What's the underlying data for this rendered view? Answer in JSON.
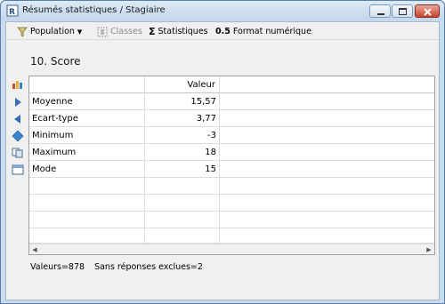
{
  "window": {
    "title": "Résumés statistiques / Stagiaire"
  },
  "toolbar": {
    "population": "Population",
    "classes": "Classes",
    "statistiques": "Statistiques",
    "format_prefix": "0.5",
    "format_label": "Format numérique"
  },
  "heading": "10. Score",
  "table": {
    "header_value": "Valeur",
    "rows": [
      {
        "label": "Moyenne",
        "value": "15,57"
      },
      {
        "label": "Ecart-type",
        "value": "3,77"
      },
      {
        "label": "Minimum",
        "value": "-3"
      },
      {
        "label": "Maximum",
        "value": "18"
      },
      {
        "label": "Mode",
        "value": "15"
      }
    ]
  },
  "status": {
    "valeurs": "Valeurs=878",
    "exclues": "Sans réponses exclues=2"
  },
  "colors": {
    "title_bar": "#c9dbee",
    "close_button": "#c7432b",
    "grid_border": "#a0a0a0"
  },
  "icons": [
    "app-icon",
    "filter-icon",
    "classes-icon",
    "sigma-icon",
    "chart-icon",
    "next-icon",
    "prev-icon",
    "diamond-icon",
    "copy-icon",
    "window-icon"
  ]
}
